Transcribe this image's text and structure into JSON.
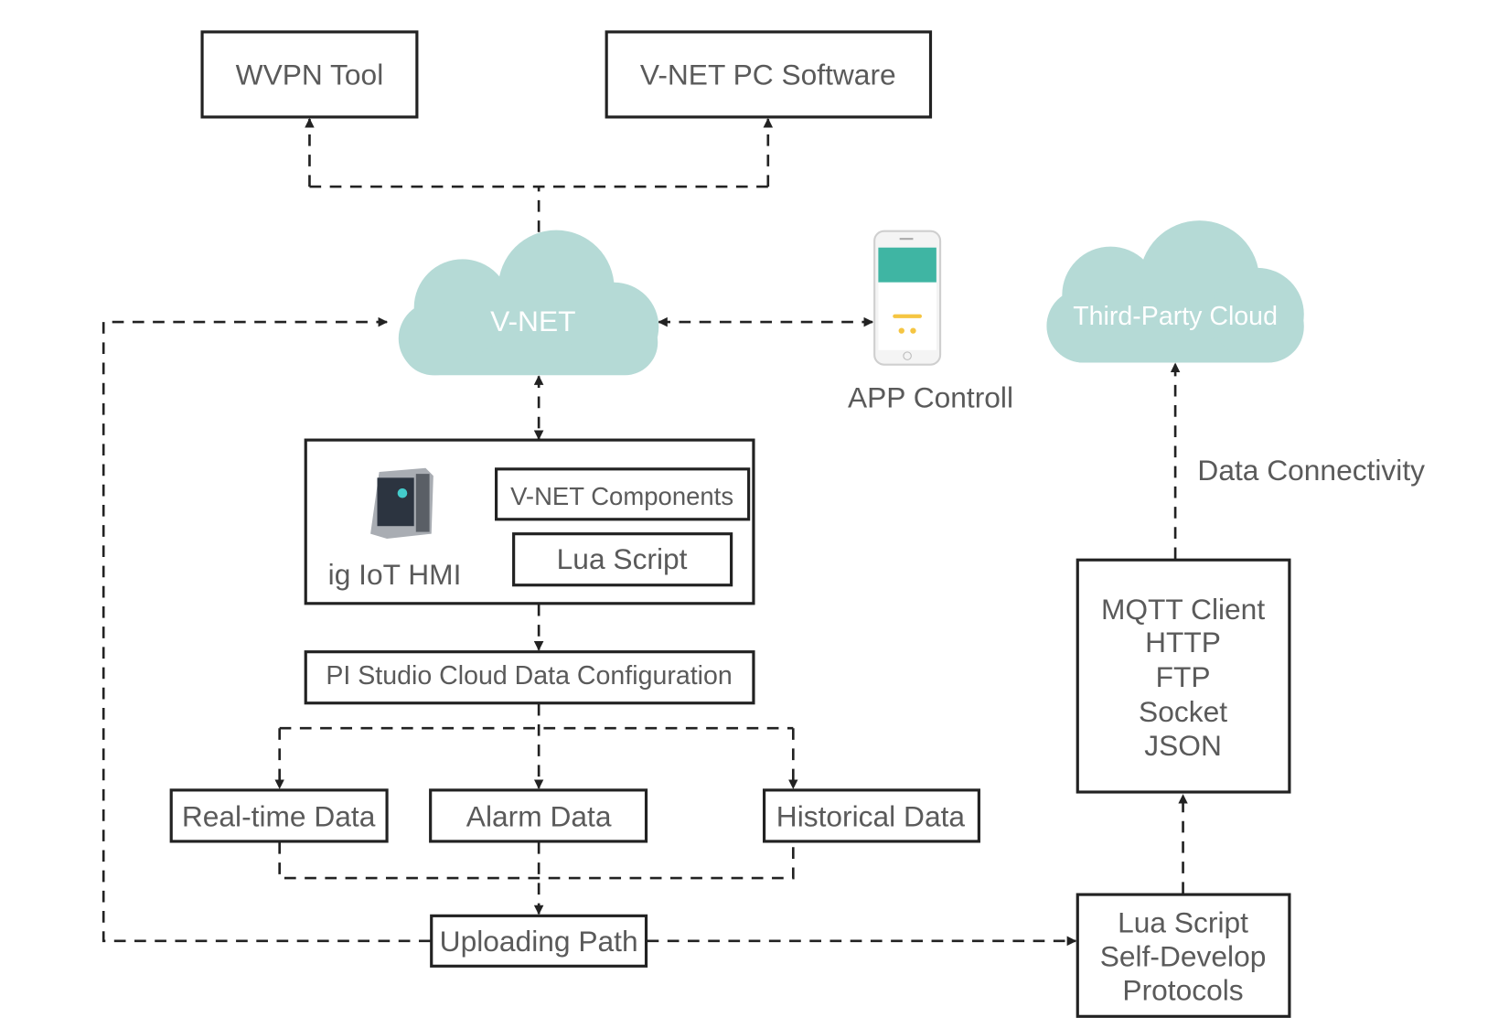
{
  "nodes": {
    "wvpn_tool": "WVPN Tool",
    "vnet_pc_software": "V-NET PC Software",
    "vnet_cloud": "V-NET",
    "app_control": "APP Controll",
    "third_party_cloud": "Third-Party Cloud",
    "data_connectivity": "Data Connectivity",
    "hmi_label": "ig IoT HMI",
    "vnet_components": "V-NET Components",
    "lua_script": "Lua Script",
    "pi_studio": "PI Studio Cloud Data Configuration",
    "realtime_data": "Real-time Data",
    "alarm_data": "Alarm Data",
    "historical_data": "Historical Data",
    "uploading_path": "Uploading Path",
    "protocols": [
      "MQTT Client",
      "HTTP",
      "FTP",
      "Socket",
      "JSON"
    ],
    "lua_self_develop": [
      "Lua Script",
      "Self-Develop",
      "Protocols"
    ]
  },
  "colors": {
    "cloud": "#b5dad6",
    "phone_header": "#3fb5a3",
    "text": "#5a5a5a",
    "stroke": "#222222"
  }
}
